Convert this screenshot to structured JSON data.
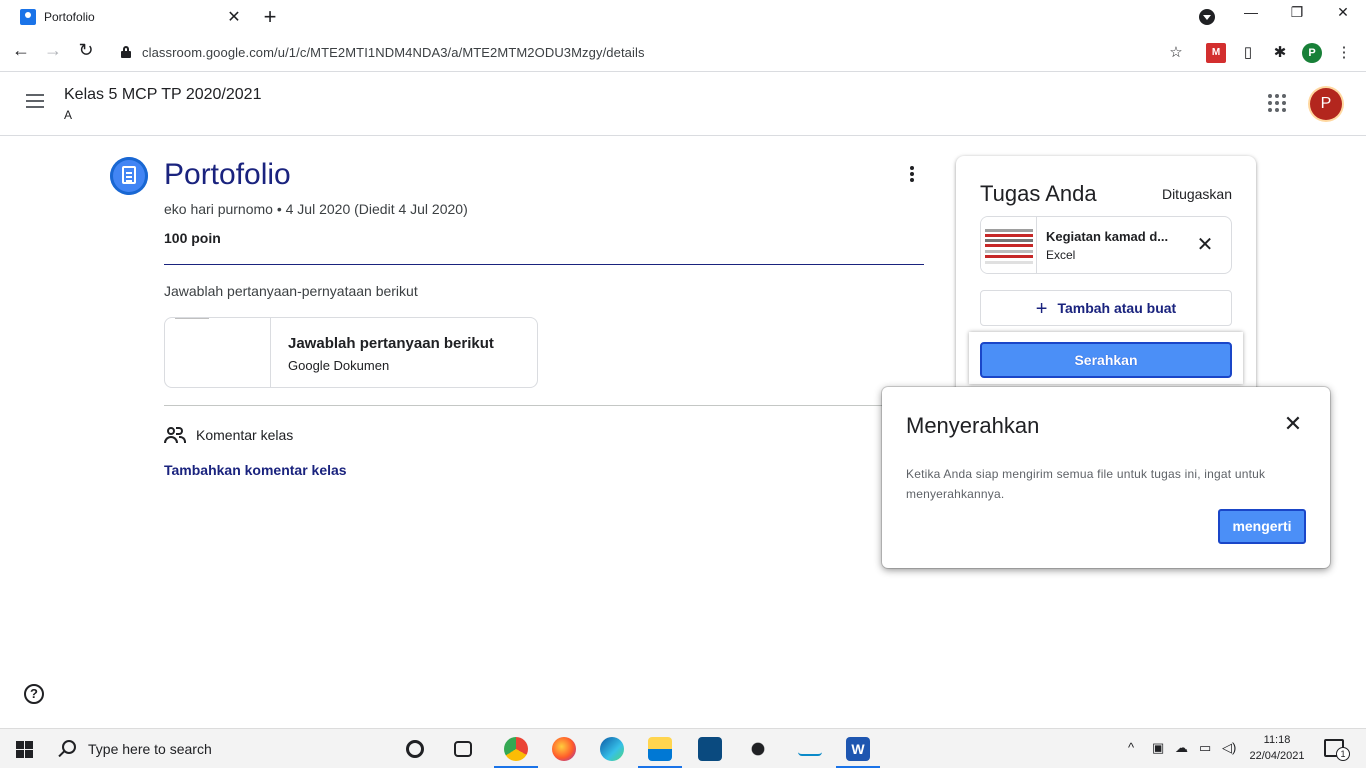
{
  "browser": {
    "tab_title": "Portofolio",
    "tab_close": "✕",
    "new_tab": "+",
    "url": "classroom.google.com/u/1/c/MTE2MTI1NDM4NDA3/a/MTE2MTM2ODU3Mzgy/details",
    "win_minimize": "—",
    "win_restore": "❐",
    "win_close": "✕",
    "profile_initial": "P",
    "ext_icon_letter": "M"
  },
  "header": {
    "class_name": "Kelas 5 MCP TP 2020/2021",
    "section": "A",
    "avatar_initial": "P"
  },
  "assignment": {
    "title": "Portofolio",
    "meta": "eko hari purnomo • 4 Jul 2020 (Diedit 4 Jul 2020)",
    "points": "100 poin",
    "instructions": "Jawablah pertanyaan-pernyataan berikut",
    "attachment": {
      "title": "Jawablah pertanyaan berikut",
      "type": "Google Dokumen"
    }
  },
  "comments": {
    "label": "Komentar kelas",
    "add": "Tambahkan komentar kelas"
  },
  "your_work": {
    "title": "Tugas Anda",
    "status": "Ditugaskan",
    "file_name": "Kegiatan kamad d...",
    "file_type": "Excel",
    "add_create": "Tambah atau buat",
    "submit": "Serahkan"
  },
  "popup": {
    "title": "Menyerahkan",
    "body": "Ketika Anda siap mengirim semua file untuk tugas ini, ingat untuk menyerahkannya.",
    "button": "mengerti"
  },
  "taskbar": {
    "search_placeholder": "Type here to search",
    "time": "11:18",
    "date": "22/04/2021",
    "notification_count": "1"
  },
  "colors": {
    "accent_blue": "#1a237e",
    "button_blue": "#4b8ff7",
    "avatar_red": "#b3261e"
  }
}
